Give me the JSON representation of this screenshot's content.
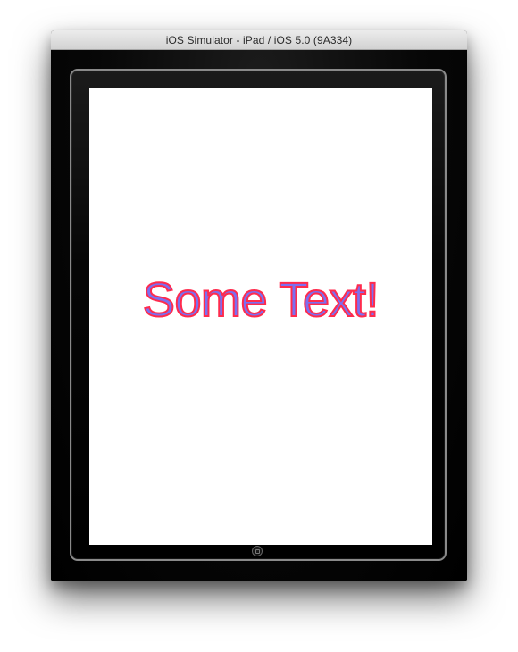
{
  "window": {
    "title": "iOS Simulator - iPad / iOS 5.0 (9A334)"
  },
  "screen": {
    "text": "Some Text!",
    "text_fill_color": "#7b6ff0",
    "text_stroke_color": "#ff2b4d",
    "background_color": "#ffffff"
  },
  "device": {
    "home_button_icon": "home-button-icon"
  }
}
